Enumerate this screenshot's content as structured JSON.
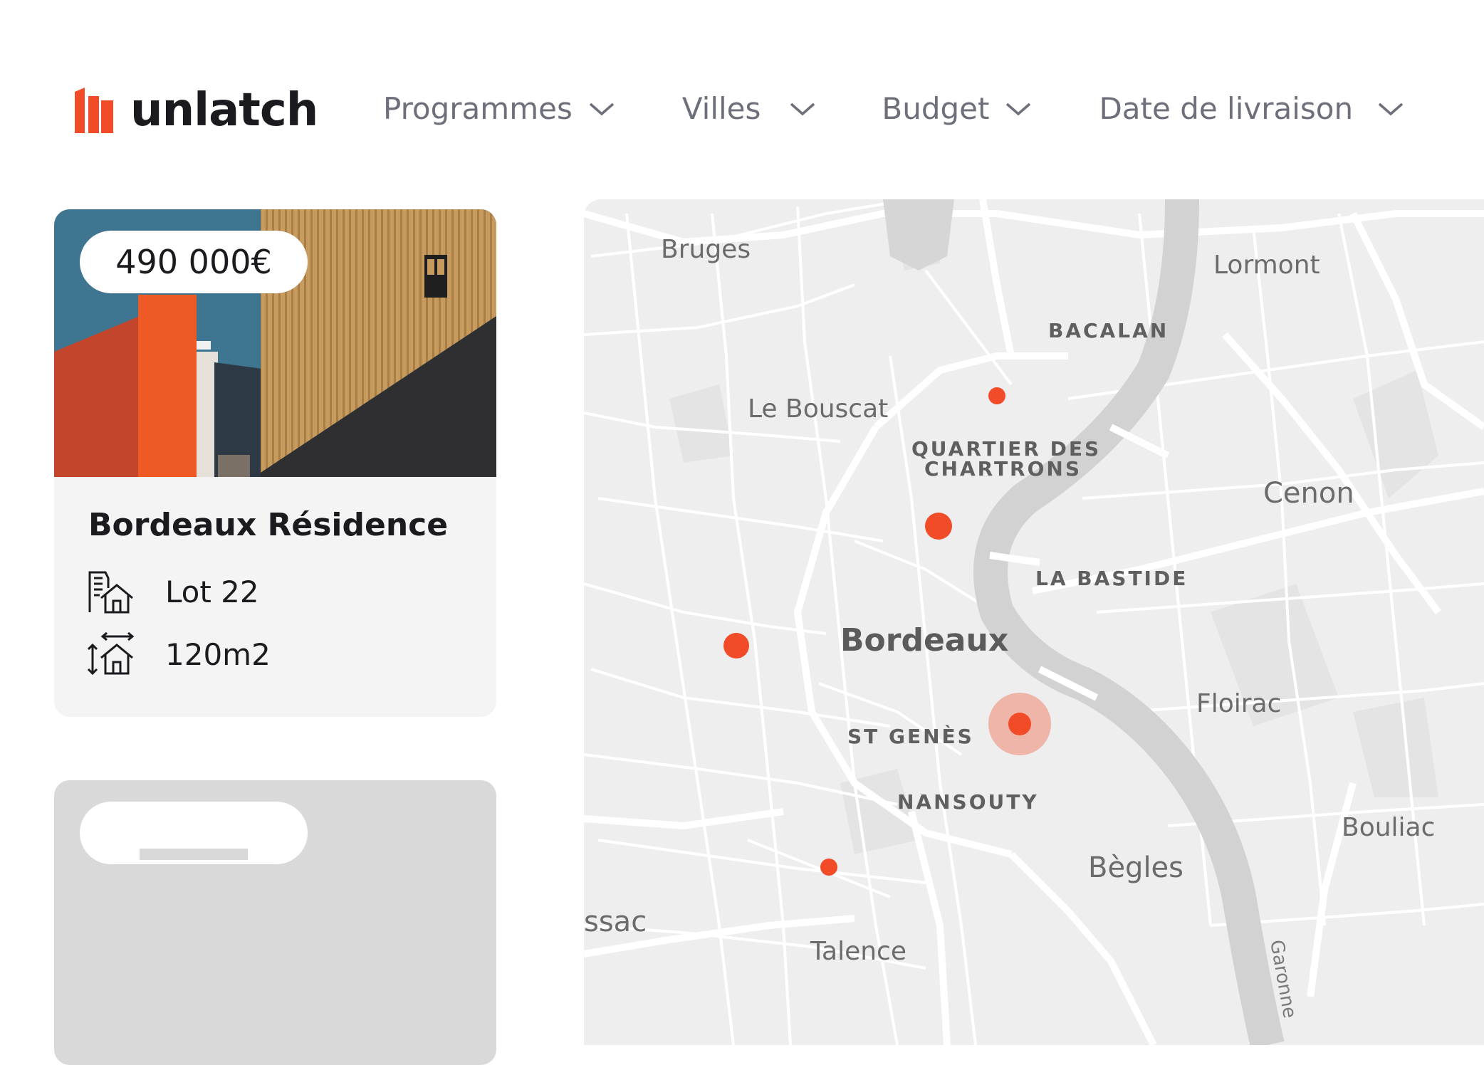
{
  "brand": {
    "name": "unlatch",
    "accent_color": "#f24b28"
  },
  "nav": {
    "items": [
      {
        "label": "Programmes",
        "icon": "chevron-down-icon"
      },
      {
        "label": "Villes",
        "icon": "chevron-down-icon"
      },
      {
        "label": "Budget",
        "icon": "chevron-down-icon"
      },
      {
        "label": "Date de livraison",
        "icon": "chevron-down-icon"
      }
    ]
  },
  "listing": {
    "price": "490 000€",
    "title": "Bordeaux Résidence",
    "lot": "Lot 22",
    "area": "120m2",
    "lot_icon": "building-house-icon",
    "area_icon": "house-dimensions-icon"
  },
  "placeholder_card": {
    "state": "loading"
  },
  "map": {
    "labels": {
      "bruges": "Bruges",
      "lormont": "Lormont",
      "bacalan": "BACALAN",
      "le_bouscat": "Le Bouscat",
      "chartrons_1": "QUARTIER DES",
      "chartrons_2": "CHARTRONS",
      "cenon": "Cenon",
      "la_bastide": "LA BASTIDE",
      "bordeaux": "Bordeaux",
      "floirac": "Floirac",
      "st_genes": "ST GENÈS",
      "nansouty": "NANSOUTY",
      "bouliac": "Bouliac",
      "begles": "Bègles",
      "ssac": "ssac",
      "talence": "Talence",
      "garonne": "Garonne"
    },
    "marker_color": "#f24b28",
    "markers": 5,
    "selected_marker": 1
  }
}
